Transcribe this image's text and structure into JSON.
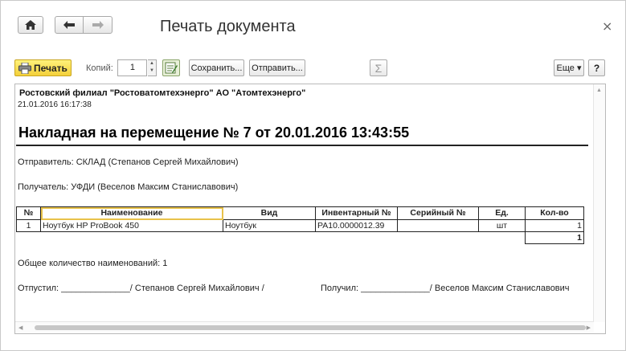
{
  "window": {
    "title": "Печать документа",
    "close_symbol": "×"
  },
  "toolbar": {
    "print_label": "Печать",
    "copies_label": "Копий:",
    "copies_value": "1",
    "save_label": "Сохранить...",
    "send_label": "Отправить...",
    "sum_symbol": "Σ",
    "more_label": "Еще ▾",
    "help_label": "?"
  },
  "icons": {
    "home": "home-icon",
    "back": "arrow-left-icon",
    "forward": "arrow-right-icon",
    "print": "printer-icon",
    "edit": "edit-document-icon",
    "sum": "sigma-icon",
    "close": "close-icon"
  },
  "colors": {
    "print_button": "#f4d03a",
    "selection": "#e8c24a"
  },
  "document": {
    "organization": "Ростовский филиал \"Ростоватомтехэнерго\" АО \"Атомтехэнерго\"",
    "printed_at": "21.01.2016 16:17:38",
    "heading": "Накладная на перемещение № 7 от 20.01.2016 13:43:55",
    "sender": "Отправитель: СКЛАД (Степанов Сергей Михайлович)",
    "receiver": "Получатель: УФДИ (Веселов Максим Станиславович)",
    "table": {
      "headers": [
        "№",
        "Наименование",
        "Вид",
        "Инвентарный №",
        "Серийный №",
        "Ед.",
        "Кол-во"
      ],
      "rows": [
        [
          "1",
          "Ноутбук HP ProBook 450",
          "Ноутбук",
          "РА10.0000012.39",
          "",
          "шт",
          "1"
        ]
      ],
      "total": "1"
    },
    "total_count": "Общее количество наименований: 1",
    "released_by": "Отпустил: ______________/ Степанов Сергей Михайлович /",
    "received_by": "Получил: ______________/ Веселов Максим Станиславович"
  }
}
